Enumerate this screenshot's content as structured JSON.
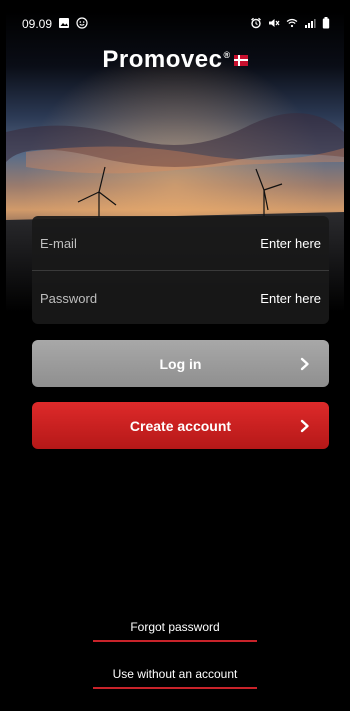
{
  "status_bar": {
    "time": "09.09",
    "left_icons": [
      "image-icon",
      "emoji-icon"
    ],
    "right_icons": [
      "alarm-icon",
      "mute-icon",
      "wifi-icon",
      "signal-icon",
      "battery-icon"
    ]
  },
  "brand": {
    "name": "Promovec",
    "reg": "®"
  },
  "form": {
    "email_label": "E-mail",
    "email_placeholder": "Enter here",
    "password_label": "Password",
    "password_placeholder": "Enter here"
  },
  "buttons": {
    "login_label": "Log in",
    "create_label": "Create account"
  },
  "links": {
    "forgot_label": "Forgot password",
    "guest_label": "Use without an account"
  },
  "colors": {
    "accent_red": "#c9232a",
    "login_gray": "#9a9a9a"
  }
}
